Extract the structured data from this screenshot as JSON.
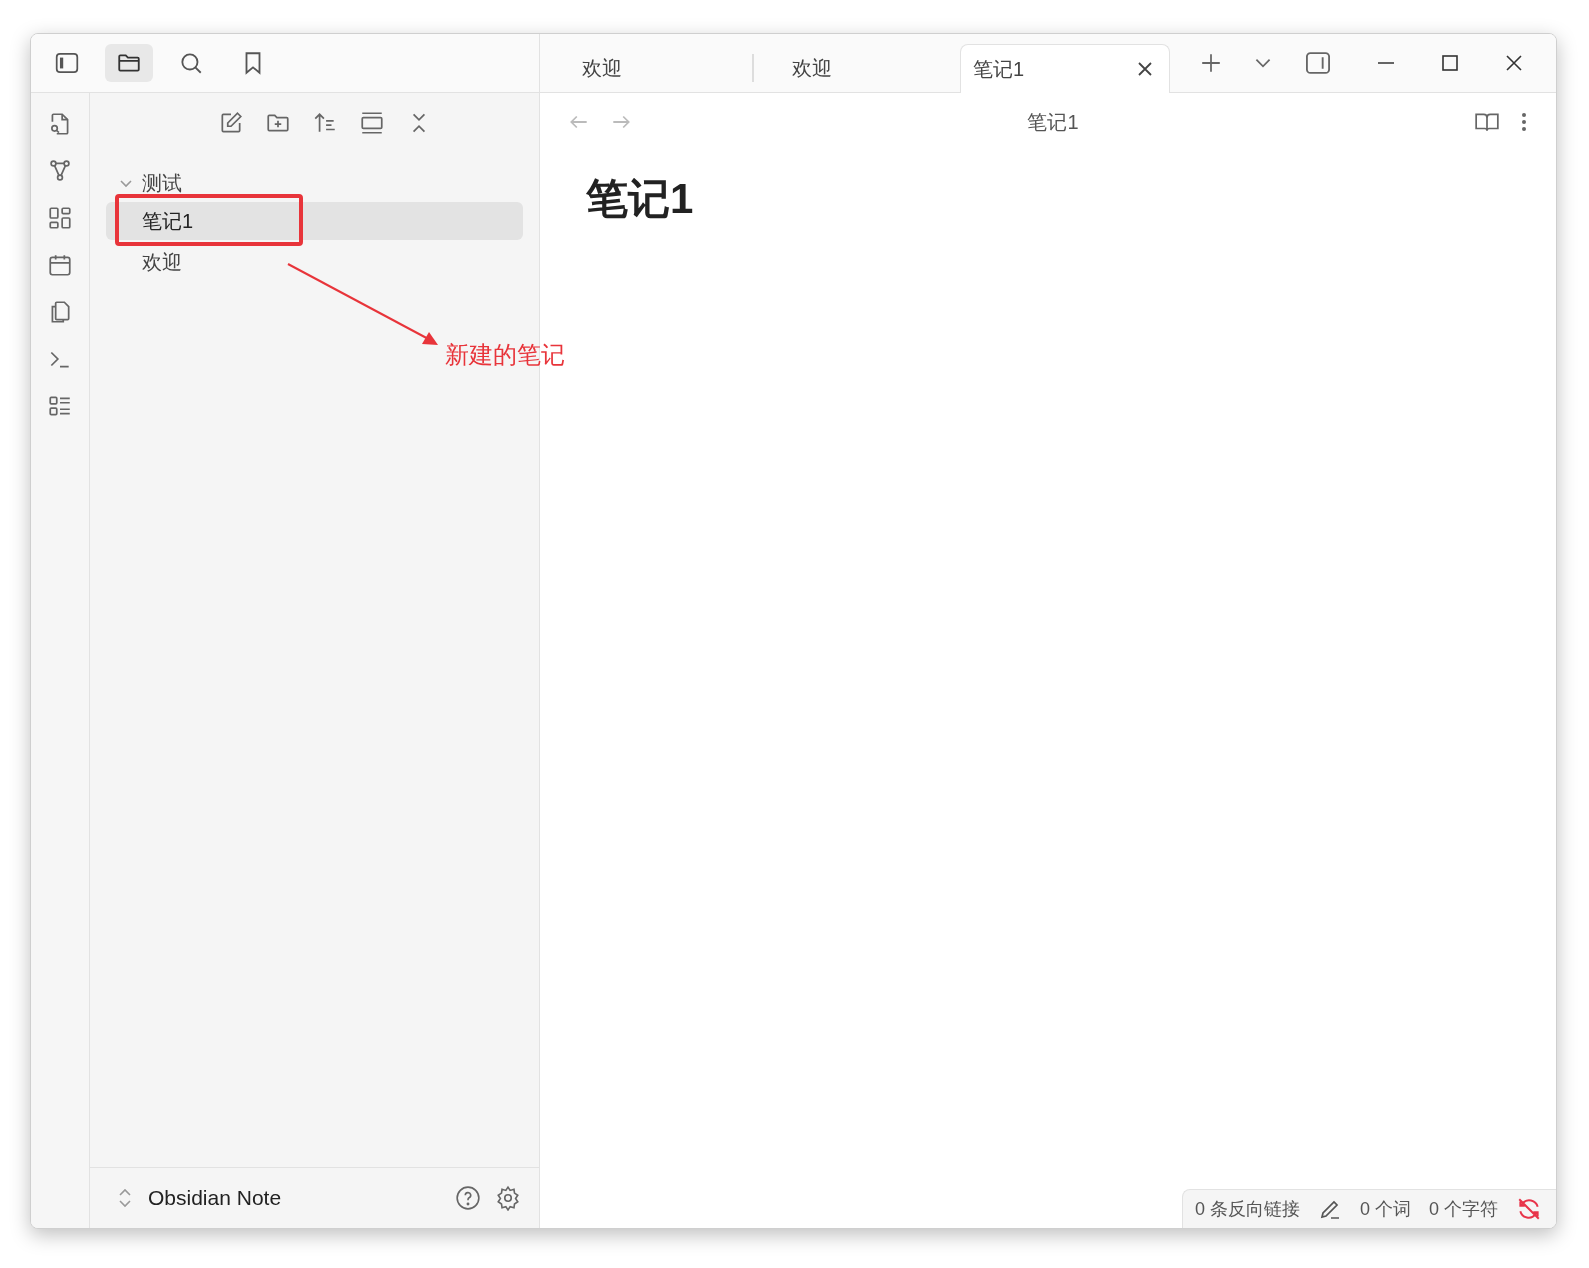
{
  "left_tabs": [
    {
      "kind": "files",
      "selected": true
    },
    {
      "kind": "search",
      "selected": false
    },
    {
      "kind": "bookmarks",
      "selected": false
    }
  ],
  "tabs": [
    {
      "label": "欢迎",
      "selected": false
    },
    {
      "label": "欢迎",
      "selected": false
    },
    {
      "label": "笔记1",
      "selected": true
    }
  ],
  "file_tree": [
    {
      "label": "测试",
      "expanded": true,
      "children": [
        {
          "label": "笔记1",
          "selected": true
        },
        {
          "label": "欢迎",
          "selected": false
        }
      ]
    }
  ],
  "breadcrumb": "笔记1",
  "note": {
    "title": "笔记1"
  },
  "vault": {
    "name": "Obsidian Note"
  },
  "status_bar": {
    "backlinks": "0 条反向链接",
    "words": "0 个词",
    "chars": "0 个字符"
  },
  "annotation": {
    "label": "新建的笔记"
  }
}
